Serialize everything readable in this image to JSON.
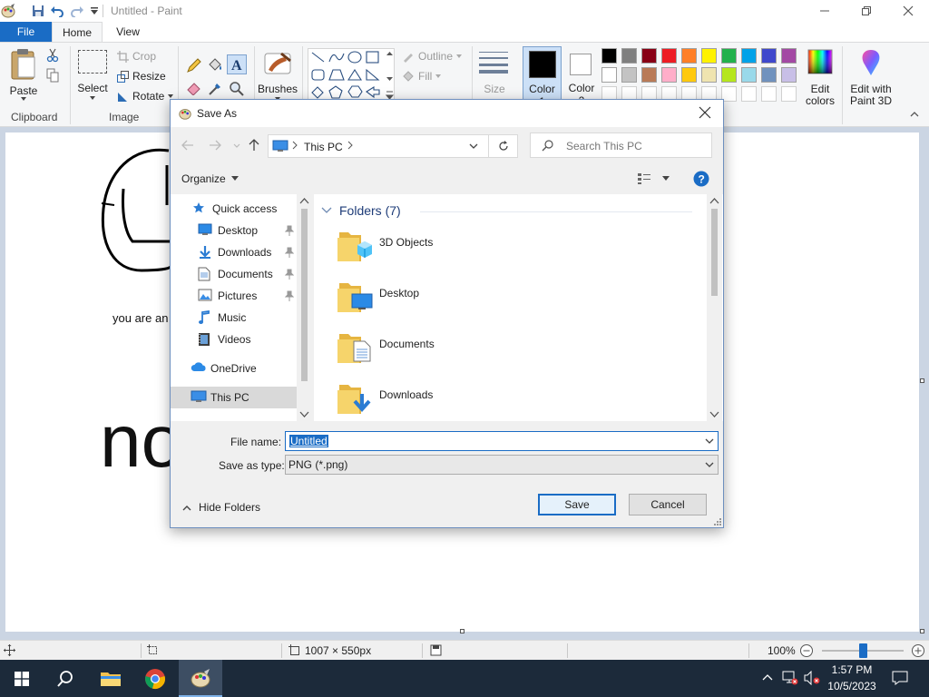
{
  "window": {
    "title": "Untitled - Paint",
    "min_icon": "minimize-icon",
    "max_icon": "maximize-icon",
    "close_icon": "close-icon"
  },
  "quick_access": [
    "save-icon",
    "undo-icon",
    "redo-icon",
    "customize-icon"
  ],
  "tabs": {
    "file": "File",
    "home": "Home",
    "view": "View"
  },
  "ribbon": {
    "clipboard": {
      "paste": "Paste",
      "group": "Clipboard"
    },
    "image": {
      "select": "Select",
      "crop": "Crop",
      "resize": "Resize",
      "rotate": "Rotate",
      "group": "Image"
    },
    "tools": {
      "brushes": "Brushes"
    },
    "shapes": {
      "outline": "Outline",
      "fill": "Fill"
    },
    "size": "Size",
    "color1_label": "Color",
    "color1_number": "1",
    "color2_label": "Color",
    "color2_number": "2",
    "edit_colors_1": "Edit",
    "edit_colors_2": "colors",
    "paint3d_1": "Edit with",
    "paint3d_2": "Paint 3D",
    "palette_row1": [
      "#000000",
      "#7f7f7f",
      "#880015",
      "#ed1c24",
      "#ff7f27",
      "#fff200",
      "#22b14c",
      "#00a2e8",
      "#3f48cc",
      "#a349a4"
    ],
    "palette_row2": [
      "#ffffff",
      "#c3c3c3",
      "#b97a57",
      "#ffaec9",
      "#ffc90e",
      "#efe4b0",
      "#b5e61d",
      "#99d9ea",
      "#7092be",
      "#c8bfe7"
    ],
    "color1_value": "#000000",
    "color2_value": "#ffffff"
  },
  "canvas": {
    "small_text": "you are an",
    "big_text": "no"
  },
  "statusbar": {
    "dimensions": "1007 × 550px",
    "zoom": "100%",
    "zoom_fraction": 0.5
  },
  "taskbar": {
    "time": "1:57 PM",
    "date": "10/5/2023"
  },
  "dialog": {
    "title": "Save As",
    "address_segment": "This PC",
    "search_placeholder": "Search This PC",
    "organize": "Organize",
    "folders_header": "Folders (7)",
    "nav_items": [
      {
        "label": "Quick access",
        "icon": "star-icon",
        "pinned": false
      },
      {
        "label": "Desktop",
        "icon": "desktop-icon",
        "pinned": true
      },
      {
        "label": "Downloads",
        "icon": "downloads-icon",
        "pinned": true
      },
      {
        "label": "Documents",
        "icon": "documents-icon",
        "pinned": true
      },
      {
        "label": "Pictures",
        "icon": "pictures-icon",
        "pinned": true
      },
      {
        "label": "Music",
        "icon": "music-icon",
        "pinned": false
      },
      {
        "label": "Videos",
        "icon": "videos-icon",
        "pinned": false
      },
      {
        "label": "OneDrive",
        "icon": "onedrive-icon",
        "pinned": false
      },
      {
        "label": "This PC",
        "icon": "this-pc-icon",
        "pinned": false
      }
    ],
    "folders": [
      {
        "name": "3D Objects",
        "icon": "3d-objects-folder-icon"
      },
      {
        "name": "Desktop",
        "icon": "desktop-folder-icon"
      },
      {
        "name": "Documents",
        "icon": "documents-folder-icon"
      },
      {
        "name": "Downloads",
        "icon": "downloads-folder-icon"
      }
    ],
    "file_name_label": "File name:",
    "file_name_value": "Untitled",
    "save_type_label": "Save as type:",
    "save_type_value": "PNG (*.png)",
    "hide_folders": "Hide Folders",
    "save": "Save",
    "cancel": "Cancel"
  }
}
